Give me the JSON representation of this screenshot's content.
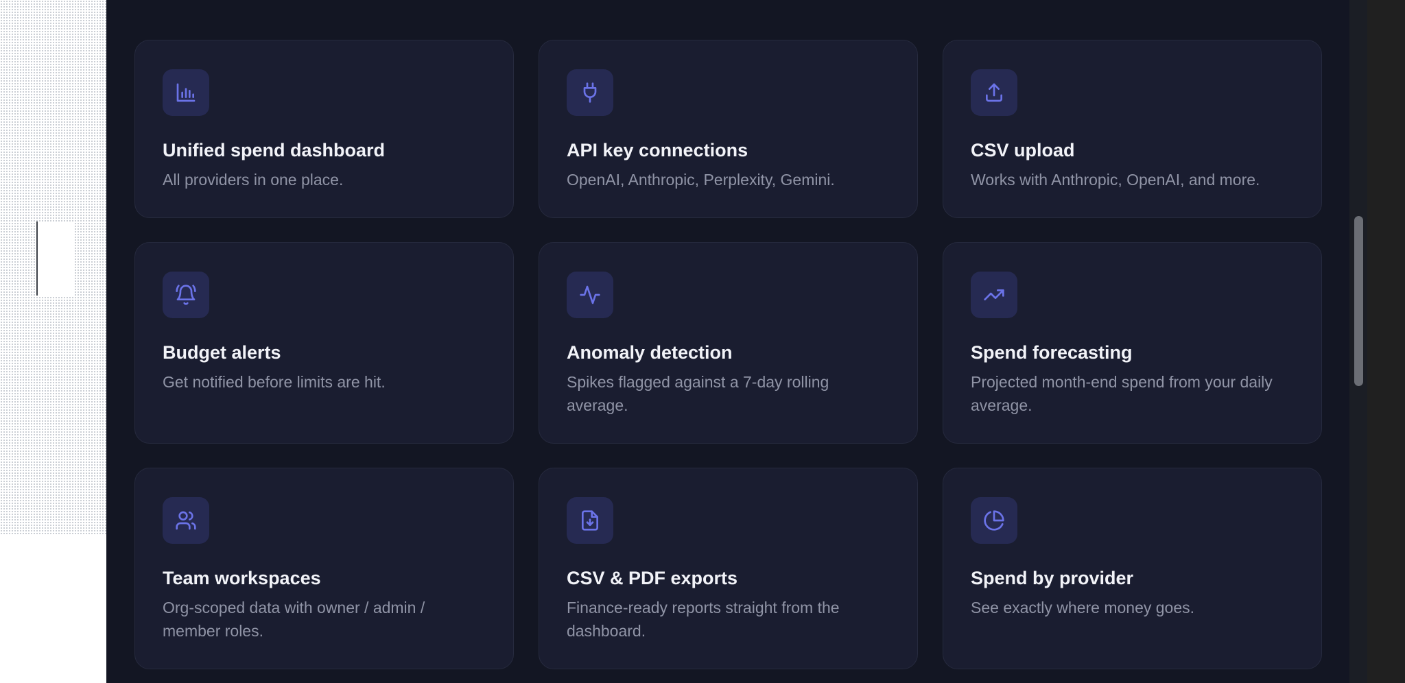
{
  "colors": {
    "page_bg": "#131623",
    "card_bg": "#1a1d30",
    "card_border": "#262a3e",
    "icon_tile_bg": "#262a52",
    "icon_accent": "#6b73e8",
    "title_text": "#f2f3f8",
    "desc_text": "#9094a6"
  },
  "features": [
    {
      "icon": "bar-chart-icon",
      "title": "Unified spend dashboard",
      "description": "All providers in one place."
    },
    {
      "icon": "plug-icon",
      "title": "API key connections",
      "description": "OpenAI, Anthropic, Perplexity, Gemini."
    },
    {
      "icon": "upload-icon",
      "title": "CSV upload",
      "description": "Works with Anthropic, OpenAI, and more."
    },
    {
      "icon": "bell-ringing-icon",
      "title": "Budget alerts",
      "description": "Get notified before limits are hit."
    },
    {
      "icon": "activity-icon",
      "title": "Anomaly detection",
      "description": "Spikes flagged against a 7-day rolling average."
    },
    {
      "icon": "trending-up-icon",
      "title": "Spend forecasting",
      "description": "Projected month-end spend from your daily average."
    },
    {
      "icon": "users-icon",
      "title": "Team workspaces",
      "description": "Org-scoped data with owner / admin / member roles."
    },
    {
      "icon": "file-download-icon",
      "title": "CSV & PDF exports",
      "description": "Finance-ready reports straight from the dashboard."
    },
    {
      "icon": "pie-chart-icon",
      "title": "Spend by provider",
      "description": "See exactly where money goes."
    }
  ]
}
